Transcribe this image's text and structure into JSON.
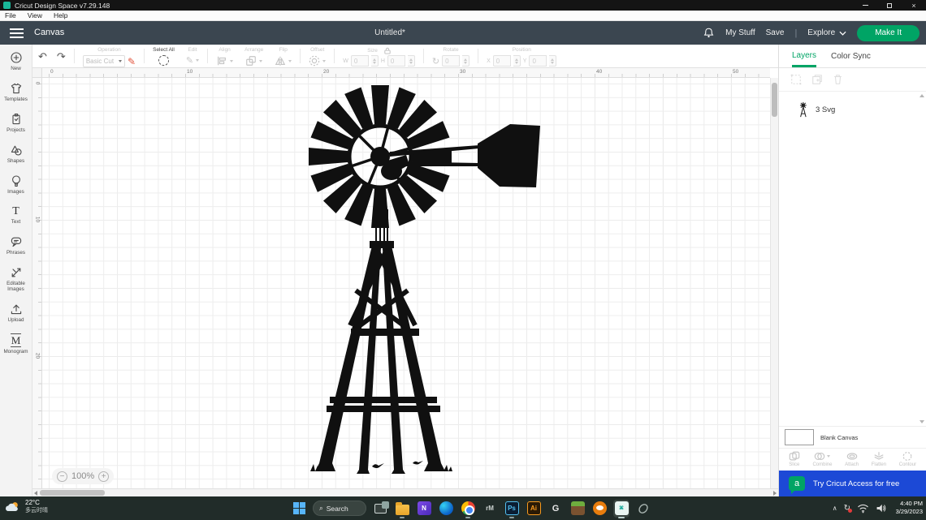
{
  "window": {
    "app_title": "Cricut Design Space  v7.29.148",
    "menu": [
      "File",
      "View",
      "Help"
    ]
  },
  "header": {
    "canvas_label": "Canvas",
    "doc_title": "Untitled*",
    "my_stuff_label": "My Stuff",
    "save_label": "Save",
    "sep": "|",
    "explore_label": "Explore",
    "make_it_label": "Make It"
  },
  "toolbar": {
    "operation_label": "Operation",
    "operation_value": "Basic Cut",
    "select_all_label": "Select All",
    "edit_label": "Edit",
    "align_label": "Align",
    "arrange_label": "Arrange",
    "flip_label": "Flip",
    "offset_label": "Offset",
    "size_label": "Size",
    "w_label": "W",
    "w_value": "0",
    "h_label": "H",
    "h_value": "0",
    "rotate_label": "Rotate",
    "rotate_value": "0",
    "position_label": "Position",
    "x_label": "X",
    "x_value": "0",
    "y_label": "Y",
    "y_value": "0"
  },
  "sidebar": {
    "items": [
      {
        "label": "New"
      },
      {
        "label": "Templates"
      },
      {
        "label": "Projects"
      },
      {
        "label": "Shapes"
      },
      {
        "label": "Images"
      },
      {
        "label": "Text"
      },
      {
        "label": "Phrases"
      },
      {
        "label": "Editable Images"
      },
      {
        "label": "Upload"
      },
      {
        "label": "Monogram"
      }
    ]
  },
  "canvas": {
    "zoom_value": "100%",
    "ruler_top": [
      "0",
      "10",
      "20",
      "30",
      "40",
      "50"
    ],
    "ruler_left": [
      "0",
      "10",
      "20"
    ]
  },
  "layers_panel": {
    "tabs": [
      {
        "label": "Layers"
      },
      {
        "label": "Color Sync"
      }
    ],
    "layer_item_label": "3 Svg",
    "blank_canvas_label": "Blank Canvas",
    "actions": [
      {
        "label": "Slice"
      },
      {
        "label": "Combine"
      },
      {
        "label": "Attach"
      },
      {
        "label": "Flatten"
      },
      {
        "label": "Contour"
      }
    ],
    "banner_text": "Try Cricut Access for free",
    "banner_logo_letter": "a"
  },
  "taskbar": {
    "weather_temp": "22°C",
    "weather_desc": "多云时晴",
    "search_label": "Search",
    "icon_letters": {
      "notes": "N",
      "remarkable": "rM",
      "photoshop": "Ps",
      "illustrator": "Ai",
      "logitech": "G"
    },
    "time": "4:40 PM",
    "date": "3/29/2023"
  },
  "icons": {
    "undo": "↶",
    "redo": "↷",
    "pencil": "✎",
    "rotate": "↻",
    "search": "⌕",
    "close": "×",
    "zoom_out": "−",
    "zoom_in": "+",
    "text_tool": "T",
    "monogram": "M",
    "tray_chevron": "∧"
  },
  "colors": {
    "accent_green": "#00a465",
    "banner_blue": "#1c49d6",
    "header_slate": "#3b4650",
    "operation_pen": "#e2553e"
  }
}
